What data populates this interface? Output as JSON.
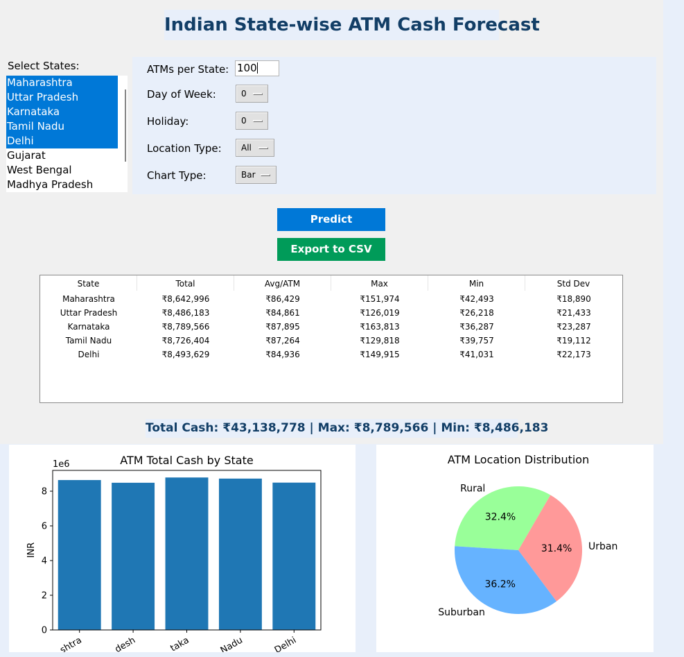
{
  "app": {
    "title": "Indian State-wise ATM Cash Forecast"
  },
  "states": {
    "label": "Select States:",
    "items": [
      {
        "name": "Maharashtra",
        "selected": true
      },
      {
        "name": "Uttar Pradesh",
        "selected": true
      },
      {
        "name": "Karnataka",
        "selected": true
      },
      {
        "name": "Tamil Nadu",
        "selected": true
      },
      {
        "name": "Delhi",
        "selected": true
      },
      {
        "name": "Gujarat",
        "selected": false
      },
      {
        "name": "West Bengal",
        "selected": false
      },
      {
        "name": "Madhya Pradesh",
        "selected": false
      }
    ]
  },
  "params": {
    "atms_label": "ATMs per State:",
    "atms_value": "100",
    "day_label": "Day of Week:",
    "day_value": "0",
    "holiday_label": "Holiday:",
    "holiday_value": "0",
    "location_label": "Location Type:",
    "location_value": "All",
    "chart_label": "Chart Type:",
    "chart_value": "Bar"
  },
  "buttons": {
    "predict": "Predict",
    "export": "Export to CSV"
  },
  "table": {
    "columns": [
      "State",
      "Total",
      "Avg/ATM",
      "Max",
      "Min",
      "Std Dev"
    ],
    "rows": [
      [
        "Maharashtra",
        "₹8,642,996",
        "₹86,429",
        "₹151,974",
        "₹42,493",
        "₹18,890"
      ],
      [
        "Uttar Pradesh",
        "₹8,486,183",
        "₹84,861",
        "₹126,019",
        "₹26,218",
        "₹21,433"
      ],
      [
        "Karnataka",
        "₹8,789,566",
        "₹87,895",
        "₹163,813",
        "₹36,287",
        "₹23,287"
      ],
      [
        "Tamil Nadu",
        "₹8,726,404",
        "₹87,264",
        "₹129,818",
        "₹39,757",
        "₹19,112"
      ],
      [
        "Delhi",
        "₹8,493,629",
        "₹84,936",
        "₹149,915",
        "₹41,031",
        "₹22,173"
      ]
    ]
  },
  "summary": {
    "text": "Total Cash: ₹43,138,778   |   Max: ₹8,789,566   |   Min: ₹8,486,183"
  },
  "chart_data": [
    {
      "type": "bar",
      "title": "ATM Total Cash by State",
      "ylabel": "INR",
      "y_offset_label": "1e6",
      "categories": [
        "Maharashtra",
        "Uttar Pradesh",
        "Karnataka",
        "Tamil Nadu",
        "Delhi"
      ],
      "tick_labels": [
        "shtra",
        "desh",
        "taka",
        "Nadu",
        "Delhi"
      ],
      "values": [
        8642996,
        8486183,
        8789566,
        8726404,
        8493629
      ],
      "ylim": [
        0,
        9200000
      ],
      "yticks": [
        0,
        2,
        4,
        6,
        8
      ],
      "color": "#1f77b4",
      "grid": false
    },
    {
      "type": "pie",
      "title": "ATM Location Distribution",
      "labels": [
        "Rural",
        "Suburban",
        "Urban"
      ],
      "values": [
        32.4,
        36.2,
        31.4
      ],
      "pct_labels": [
        "32.4%",
        "36.2%",
        "31.4%"
      ],
      "colors": [
        "#99ff99",
        "#66b3ff",
        "#ff9999"
      ]
    }
  ]
}
